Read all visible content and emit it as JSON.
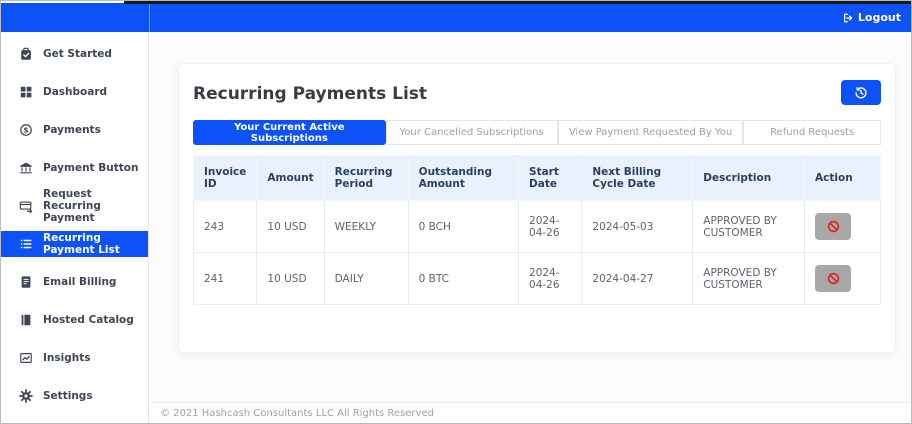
{
  "topbar": {
    "logout_label": "Logout",
    "logout_icon": "logout-icon"
  },
  "sidebar": {
    "items": [
      {
        "label": "Get Started",
        "icon": "clipboard-check-icon",
        "active": false
      },
      {
        "label": "Dashboard",
        "icon": "grid-icon",
        "active": false
      },
      {
        "label": "Payments",
        "icon": "dollar-circle-icon",
        "active": false
      },
      {
        "label": "Payment Button",
        "icon": "bank-icon",
        "active": false
      },
      {
        "label": "Request Recurring Payment",
        "icon": "card-arrow-icon",
        "active": false
      },
      {
        "label": "Recurring Payment List",
        "icon": "list-icon",
        "active": true
      },
      {
        "label": "Email Billing",
        "icon": "document-icon",
        "active": false
      },
      {
        "label": "Hosted Catalog",
        "icon": "book-icon",
        "active": false
      },
      {
        "label": "Insights",
        "icon": "chart-icon",
        "active": false
      },
      {
        "label": "Settings",
        "icon": "gear-icon",
        "active": false
      }
    ]
  },
  "main": {
    "title": "Recurring Payments List",
    "history_button_icon": "history-icon",
    "tabs": [
      {
        "label": "Your Current Active Subscriptions",
        "active": true
      },
      {
        "label": "Your Cancelled Subscriptions",
        "active": false
      },
      {
        "label": "View Payment Requested By You",
        "active": false
      },
      {
        "label": "Refund Requests",
        "active": false
      }
    ],
    "table": {
      "columns": [
        "Invoice ID",
        "Amount",
        "Recurring Period",
        "Outstanding Amount",
        "Start Date",
        "Next Billing Cycle Date",
        "Description",
        "Action"
      ],
      "rows": [
        {
          "invoice_id": "243",
          "amount": "10 USD",
          "recurring_period": "WEEKLY",
          "outstanding_amount": "0 BCH",
          "start_date": "2024-04-26",
          "next_billing_cycle_date": "2024-05-03",
          "description": "APPROVED BY CUSTOMER",
          "action_icon": "block-icon"
        },
        {
          "invoice_id": "241",
          "amount": "10 USD",
          "recurring_period": "DAILY",
          "outstanding_amount": "0 BTC",
          "start_date": "2024-04-26",
          "next_billing_cycle_date": "2024-04-27",
          "description": "APPROVED BY CUSTOMER",
          "action_icon": "block-icon"
        }
      ]
    }
  },
  "footer": {
    "copyright": "© 2021 Hashcash Consultants LLC All Rights Reserved"
  },
  "colors": {
    "primary_blue": "#0d52f7",
    "table_header_bg": "#e9f1fc",
    "action_button_gray": "#a8a8a8",
    "block_icon_red": "#e02424"
  }
}
